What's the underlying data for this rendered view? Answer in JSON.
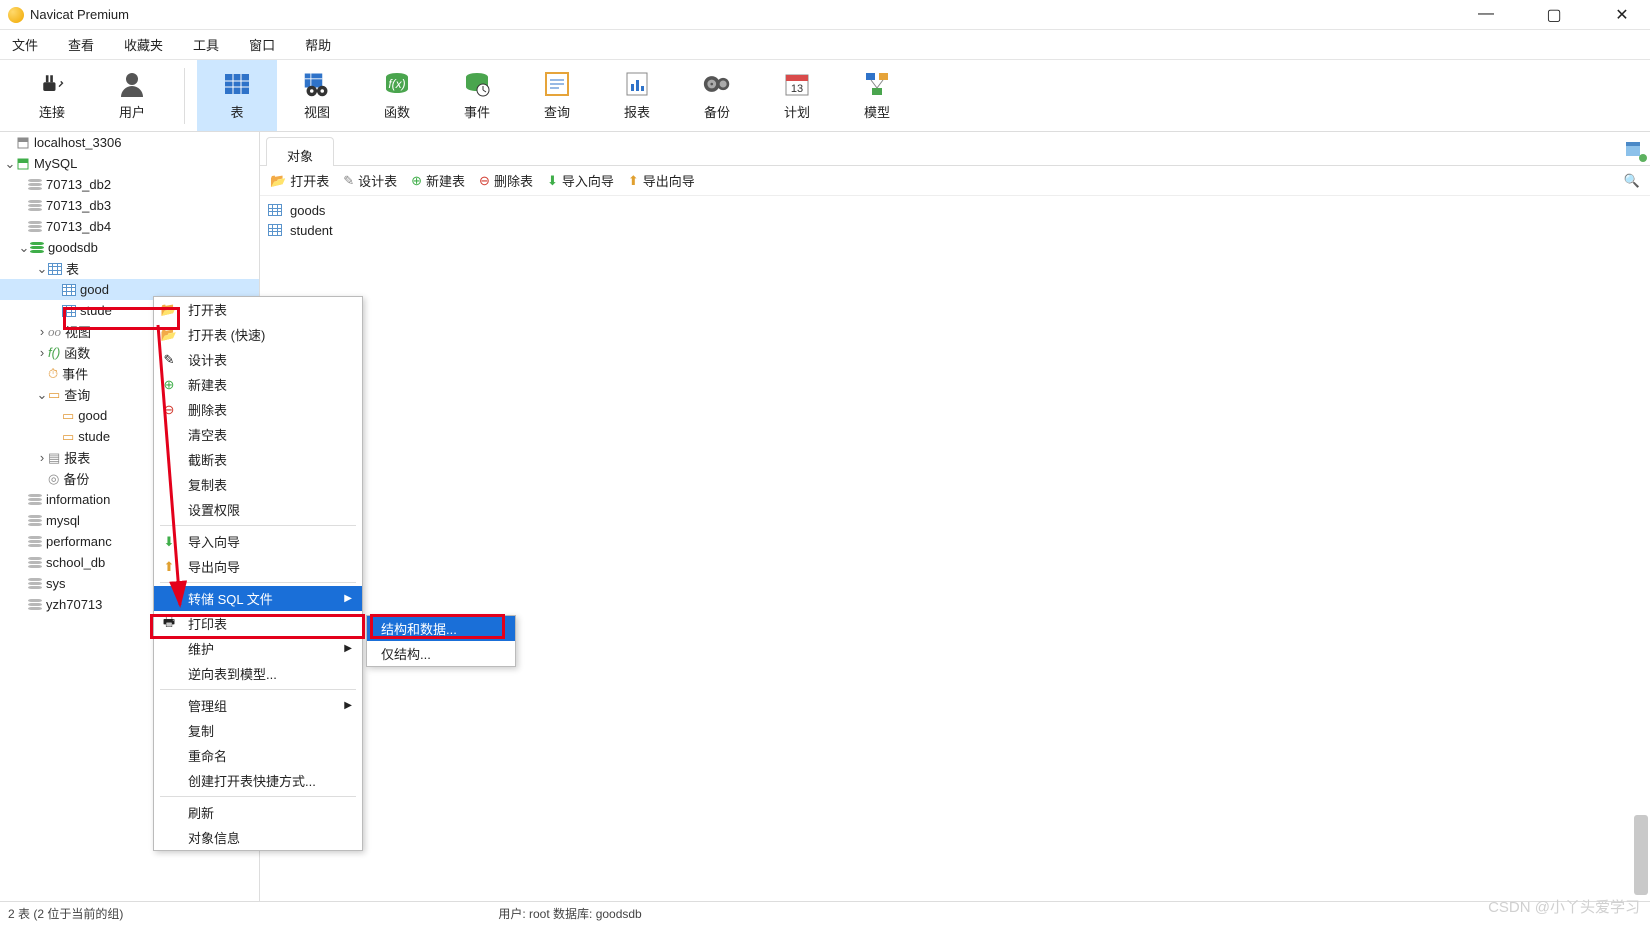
{
  "title": "Navicat Premium",
  "menubar": [
    "文件",
    "查看",
    "收藏夹",
    "工具",
    "窗口",
    "帮助"
  ],
  "toolbar": [
    {
      "key": "conn",
      "label": "连接"
    },
    {
      "key": "user",
      "label": "用户"
    },
    {
      "key": "sep"
    },
    {
      "key": "table",
      "label": "表",
      "active": true
    },
    {
      "key": "view",
      "label": "视图"
    },
    {
      "key": "func",
      "label": "函数"
    },
    {
      "key": "event",
      "label": "事件"
    },
    {
      "key": "query",
      "label": "查询"
    },
    {
      "key": "report",
      "label": "报表"
    },
    {
      "key": "backup",
      "label": "备份"
    },
    {
      "key": "plan",
      "label": "计划"
    },
    {
      "key": "model",
      "label": "模型"
    }
  ],
  "tree": {
    "conn1": "localhost_3306",
    "conn2": "MySQL",
    "dbs": [
      "70713_db2",
      "70713_db3",
      "70713_db4"
    ],
    "goodsdb": "goodsdb",
    "tables_label": "表",
    "tbl1": "good",
    "tbl2": "stude",
    "views": "视图",
    "funcs": "函数",
    "events": "事件",
    "queries": "查询",
    "q1": "good",
    "q2": "stude",
    "reports": "报表",
    "backups": "备份",
    "otherdbs": [
      "information",
      "mysql",
      "performanc",
      "school_db",
      "sys",
      "yzh70713"
    ]
  },
  "tabs": {
    "obj": "对象"
  },
  "objToolbar": [
    "打开表",
    "设计表",
    "新建表",
    "删除表",
    "导入向导",
    "导出向导"
  ],
  "objList": [
    "goods",
    "student"
  ],
  "context": {
    "open": "打开表",
    "open_fast": "打开表 (快速)",
    "design": "设计表",
    "new": "新建表",
    "delete": "删除表",
    "empty": "清空表",
    "truncate": "截断表",
    "copy": "复制表",
    "perm": "设置权限",
    "import": "导入向导",
    "export": "导出向导",
    "dump": "转储 SQL 文件",
    "print": "打印表",
    "maint": "维护",
    "rev": "逆向表到模型...",
    "group": "管理组",
    "copy2": "复制",
    "rename": "重命名",
    "shortcut": "创建打开表快捷方式...",
    "refresh": "刷新",
    "info": "对象信息"
  },
  "submenu": {
    "sd": "结构和数据...",
    "s": "仅结构..."
  },
  "status": {
    "left": "2 表 (2 位于当前的组)",
    "right": "用户: root  数据库: goodsdb"
  },
  "watermark": "CSDN @小丫头爱学习"
}
